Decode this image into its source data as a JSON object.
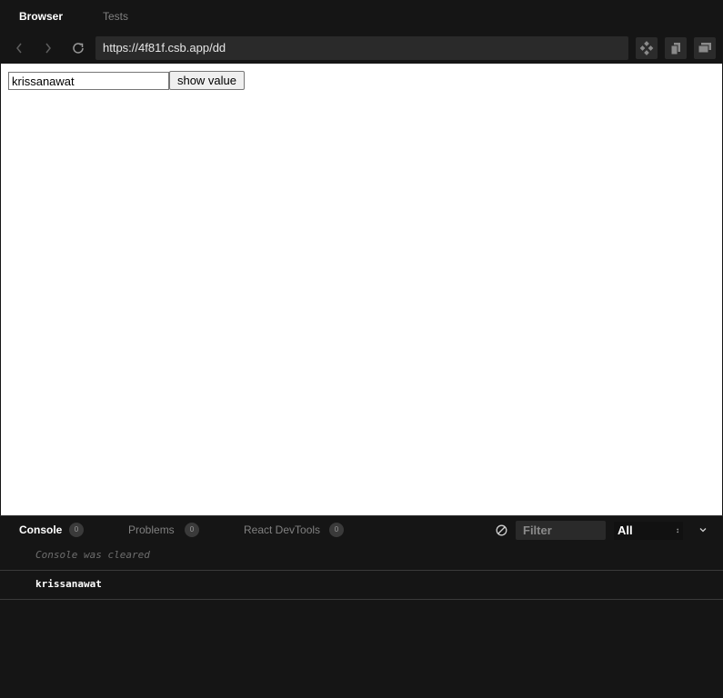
{
  "top_tabs": {
    "browser": "Browser",
    "tests": "Tests"
  },
  "nav": {
    "url": "https://4f81f.csb.app/dd",
    "icons": [
      "chevron-left-icon",
      "chevron-right-icon",
      "refresh-icon",
      "codesandbox-icon",
      "copy-icon",
      "open-window-icon"
    ]
  },
  "preview": {
    "input_value": "krissanawat",
    "button_label": "show value"
  },
  "console": {
    "tabs": [
      {
        "label": "Console",
        "count": "0"
      },
      {
        "label": "Problems",
        "count": "0"
      },
      {
        "label": "React DevTools",
        "count": "0"
      }
    ],
    "filter_placeholder": "Filter",
    "level": "All",
    "cleared_message": "Console was cleared",
    "logs": [
      "krissanawat"
    ]
  },
  "colors": {
    "background": "#151515",
    "url_bar": "#2a2a2a",
    "preview_bg": "#ffffff"
  }
}
